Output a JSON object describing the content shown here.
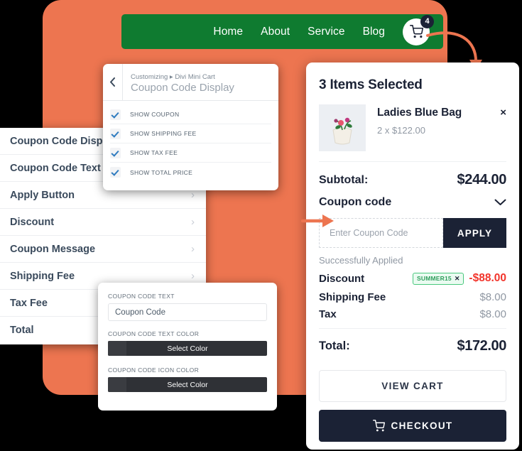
{
  "theme": {
    "backdrop_orange": "#ED7550",
    "nav_green": "#0F7B30",
    "dark_navy": "#1b2235",
    "discount_red": "#f2342b",
    "badge_green": "#2f9e5c",
    "page_background": "#000000"
  },
  "nav": {
    "links": [
      {
        "label": "Home"
      },
      {
        "label": "About"
      },
      {
        "label": "Service"
      },
      {
        "label": "Blog"
      }
    ],
    "cart_icon": "shopping-cart-icon",
    "cart_badge_count": "4"
  },
  "customizer": {
    "back_icon": "chevron-left-icon",
    "breadcrumb": "Customizing ▸ Divi Mini Cart",
    "title": "Coupon Code Display",
    "toggles": [
      {
        "label": "SHOW COUPON",
        "checked": true
      },
      {
        "label": "SHOW SHIPPING FEE",
        "checked": true
      },
      {
        "label": "SHOW TAX FEE",
        "checked": true
      },
      {
        "label": "SHOW TOTAL PRICE",
        "checked": true
      }
    ]
  },
  "settings_list": {
    "items": [
      {
        "label": "Coupon Code Display",
        "chevron": false
      },
      {
        "label": "Coupon Code Text",
        "chevron": false
      },
      {
        "label": "Apply Button",
        "chevron": true
      },
      {
        "label": "Discount",
        "chevron": true
      },
      {
        "label": "Coupon Message",
        "chevron": true
      },
      {
        "label": "Shipping Fee",
        "chevron": true
      },
      {
        "label": "Tax Fee",
        "chevron": true
      },
      {
        "label": "Total",
        "chevron": false
      }
    ],
    "chevron_icon": "chevron-right-icon"
  },
  "color_panel": {
    "text_field_label": "COUPON CODE TEXT",
    "text_field_value": "Coupon Code",
    "text_color_label": "COUPON CODE TEXT COLOR",
    "text_color_button": "Select Color",
    "icon_color_label": "COUPON CODE ICON COLOR",
    "icon_color_button": "Select Color"
  },
  "cart": {
    "title": "3 Items Selected",
    "item": {
      "thumb_icon": "product-thumbnail",
      "name": "Ladies Blue Bag",
      "quantity_price": "2 x $122.00",
      "remove_icon": "close-icon",
      "remove_label": "×"
    },
    "subtotal_label": "Subtotal:",
    "subtotal_value": "$244.00",
    "coupon_toggle_label": "Coupon code",
    "coupon_toggle_icon": "chevron-down-icon",
    "coupon_input_placeholder": "Enter Coupon Code",
    "coupon_input_value": "",
    "apply_label": "APPLY",
    "success_message": "Successfully Applied",
    "discount_label": "Discount",
    "discount_code": "SUMMER15",
    "discount_code_remove": "✕",
    "discount_value": "-$88.00",
    "shipping_label": "Shipping Fee",
    "shipping_value": "$8.00",
    "tax_label": "Tax",
    "tax_value": "$8.00",
    "total_label": "Total:",
    "total_value": "$172.00",
    "view_cart_label": "VIEW CART",
    "checkout_label": "CHECKOUT",
    "checkout_icon": "shopping-cart-icon"
  },
  "annotations": {
    "arrow_cart_to_panel": "curved-arrow-icon",
    "arrow_to_coupon_input": "arrow-right-icon"
  }
}
